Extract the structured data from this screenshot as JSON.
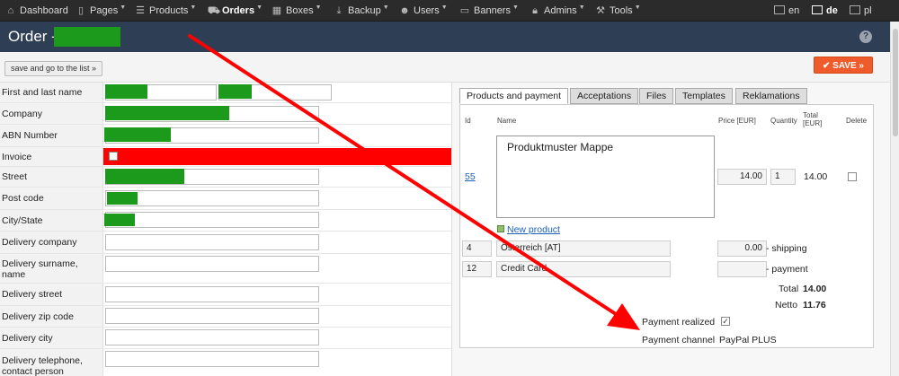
{
  "nav": {
    "items": [
      {
        "label": "Dashboard",
        "icon": "home-icon"
      },
      {
        "label": "Pages",
        "icon": "page-icon"
      },
      {
        "label": "Products",
        "icon": "list-icon"
      },
      {
        "label": "Orders",
        "icon": "cart-icon"
      },
      {
        "label": "Boxes",
        "icon": "boxes-icon"
      },
      {
        "label": "Backup",
        "icon": "download-icon"
      },
      {
        "label": "Users",
        "icon": "user-icon"
      },
      {
        "label": "Banners",
        "icon": "banner-icon"
      },
      {
        "label": "Admins",
        "icon": "lock-icon"
      },
      {
        "label": "Tools",
        "icon": "wrench-icon"
      }
    ],
    "languages": [
      "en",
      "de",
      "pl"
    ],
    "active_language": "de"
  },
  "title": "Order -",
  "toolbar": {
    "save_list_label": "save and go to the list »",
    "save_label": "SAVE »"
  },
  "form": {
    "fields": [
      {
        "label": "First and last name"
      },
      {
        "label": "Company"
      },
      {
        "label": "ABN Number"
      },
      {
        "label": "Invoice"
      },
      {
        "label": "Street"
      },
      {
        "label": "Post code"
      },
      {
        "label": "City/State"
      },
      {
        "label": "Delivery company"
      },
      {
        "label": "Delivery surname, name"
      },
      {
        "label": "Delivery street"
      },
      {
        "label": "Delivery zip code"
      },
      {
        "label": "Delivery city"
      },
      {
        "label": "Delivery telephone, contact person"
      }
    ]
  },
  "tabs": [
    "Products and payment",
    "Acceptations",
    "Files",
    "Templates",
    "Reklamations"
  ],
  "products": {
    "headers": {
      "id": "Id",
      "name": "Name",
      "price": "Price [EUR]",
      "quantity": "Quantity",
      "total": "Total [EUR]",
      "delete": "Delete"
    },
    "row": {
      "id": "55",
      "name": "Produktmuster Mappe",
      "price": "14.00",
      "quantity": "1",
      "total": "14.00"
    },
    "new_product_label": "New product",
    "shipping": {
      "id": "4",
      "name": "Österreich [AT]",
      "price": "0.00",
      "label": "- shipping"
    },
    "payment": {
      "id": "12",
      "name": "Credit Card",
      "price": "",
      "label": "- payment"
    },
    "total_label": "Total",
    "total_value": "14.00",
    "netto_label": "Netto",
    "netto_value": "11.76",
    "payment_realized_label": "Payment realized",
    "payment_channel_label": "Payment channel",
    "payment_channel_value": "PayPal PLUS"
  },
  "colors": {
    "nav_bg": "#2b2b2b",
    "title_bg": "#2d3e55",
    "save_button": "#ef5b2a",
    "redaction": "#1c9a1c",
    "annotation_red": "#ff0000",
    "link": "#1b5fb8"
  }
}
